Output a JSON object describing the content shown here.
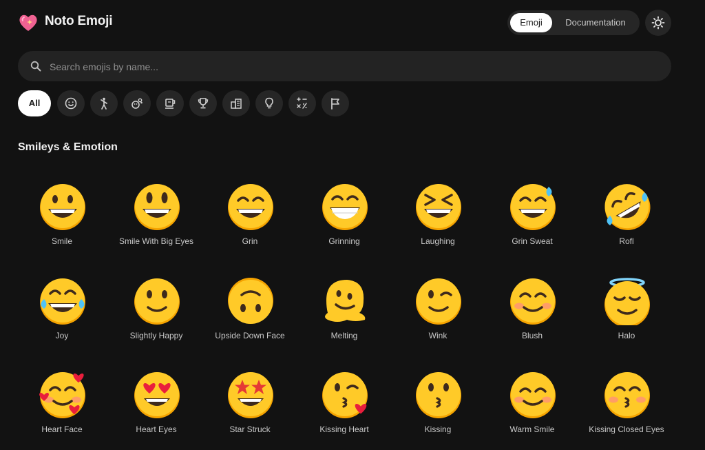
{
  "app": {
    "title": "Noto Emoji",
    "logo_icon": "sparkling-heart-icon"
  },
  "nav": {
    "emoji_label": "Emoji",
    "docs_label": "Documentation",
    "theme_icon": "sun-icon"
  },
  "search": {
    "placeholder": "Search emojis by name...",
    "value": "",
    "icon": "search-icon"
  },
  "categories": {
    "all_label": "All",
    "icons": [
      "smiley-icon",
      "person-icon",
      "animals-nature-icon",
      "food-drink-icon",
      "activities-trophy-icon",
      "travel-places-icon",
      "objects-bulb-icon",
      "symbols-icon",
      "flag-icon"
    ]
  },
  "section": {
    "title": "Smileys & Emotion"
  },
  "emojis": [
    {
      "name": "Smile",
      "glyph": "grin"
    },
    {
      "name": "Smile With Big Eyes",
      "glyph": "bigeyes"
    },
    {
      "name": "Grin",
      "glyph": "grin2"
    },
    {
      "name": "Grinning",
      "glyph": "grinning"
    },
    {
      "name": "Laughing",
      "glyph": "laughing"
    },
    {
      "name": "Grin Sweat",
      "glyph": "sweat"
    },
    {
      "name": "Rofl",
      "glyph": "rofl"
    },
    {
      "name": "Joy",
      "glyph": "joy"
    },
    {
      "name": "Slightly Happy",
      "glyph": "slight"
    },
    {
      "name": "Upside Down Face",
      "glyph": "upside"
    },
    {
      "name": "Melting",
      "glyph": "melting"
    },
    {
      "name": "Wink",
      "glyph": "wink"
    },
    {
      "name": "Blush",
      "glyph": "blush"
    },
    {
      "name": "Halo",
      "glyph": "halo"
    },
    {
      "name": "Heart Face",
      "glyph": "heartface"
    },
    {
      "name": "Heart Eyes",
      "glyph": "hearteyes"
    },
    {
      "name": "Star Struck",
      "glyph": "star"
    },
    {
      "name": "Kissing Heart",
      "glyph": "kissheart"
    },
    {
      "name": "Kissing",
      "glyph": "kissing"
    },
    {
      "name": "Warm Smile",
      "glyph": "warm"
    },
    {
      "name": "Kissing Closed Eyes",
      "glyph": "kissclosed"
    }
  ],
  "colors": {
    "background": "#121212",
    "surface": "#262626",
    "face": "#FFCA28",
    "face_shadow": "#F5A300"
  }
}
